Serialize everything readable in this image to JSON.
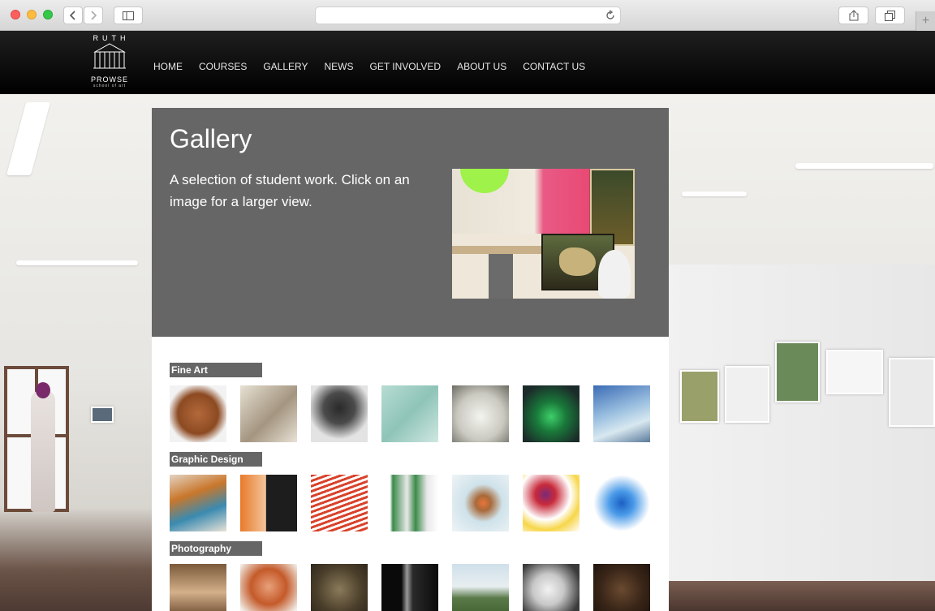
{
  "browser": {
    "url": "",
    "icons": [
      "back-icon",
      "forward-icon",
      "sidebar-icon",
      "reload-icon",
      "share-icon",
      "tabs-icon",
      "new-tab-icon"
    ]
  },
  "site": {
    "logo": {
      "line1": "RUTH",
      "line2": "PROWSE",
      "line3": "school of art"
    },
    "nav": [
      "HOME",
      "COURSES",
      "GALLERY",
      "NEWS",
      "GET INVOLVED",
      "ABOUT US",
      "CONTACT US"
    ]
  },
  "page": {
    "title": "Gallery",
    "intro": "A selection of student work. Click on an image for a larger view."
  },
  "gallery": {
    "categories": [
      {
        "name": "Fine Art",
        "thumbs": [
          {
            "bg": "radial-gradient(circle at 50% 50%, #b3693a 0%, #8c4a22 50%, #f2f2f2 75%)"
          },
          {
            "bg": "linear-gradient(135deg,#e6e0d3 0%,#a49580 55%,#e8e2d6 100%)"
          },
          {
            "bg": "radial-gradient(circle at 50% 40%, #2a2a2a 0%, #4b4b4b 35%, #e3e3e3 70%)"
          },
          {
            "bg": "linear-gradient(135deg,#b7dcd3 0%,#8fc4b8 50%,#cfe7e1 100%)"
          },
          {
            "bg": "radial-gradient(circle at 50% 55%, #f4f4ef 0%, #c9c9c0 55%, #6b6b62 100%)"
          },
          {
            "bg": "radial-gradient(circle at 50% 55%, #3dcf6a 0%, #1a7a3a 35%, #1b2b2a 80%)"
          },
          {
            "bg": "linear-gradient(160deg,#3b6bb5 0%,#9bc0e0 45%,#d8e8f0 70%,#5a7a9a 100%)"
          }
        ]
      },
      {
        "name": "Graphic Design",
        "thumbs": [
          {
            "bg": "linear-gradient(160deg,#e3d3c2 0%,#c9772b 35%,#3a8ab0 65%,#e9e2d6 100%)"
          },
          {
            "bg": "linear-gradient(90deg,#e87a2a 0%,#f4c49a 45%,#1d1d1d 46%,#1d1d1d 100%)"
          },
          {
            "bg": "repeating-linear-gradient(160deg,#d9422b 0px,#d9422b 3px,#fff 3px,#fff 6px)"
          },
          {
            "bg": "linear-gradient(90deg,#fff 0%,#fff 15%,#3b8a4a 20%,#e8e8e8 45%,#3b8a4a 60%,#e8e8e8 80%,#fff 100%)"
          },
          {
            "bg": "radial-gradient(circle at 55% 50%, #e8743a 0%, #a86a3a 18%, #cfe2ea 45%, #eef4f6 100%)"
          },
          {
            "bg": "radial-gradient(circle at 40% 35%, #7a2a7a 0%, #c82a3a 20%, #ffffff 50%, #f7d64a 70%, #ffffff 100%)"
          },
          {
            "bg": "radial-gradient(circle at 50% 50%, #1b5fc4 0%, #4a9ae8 30%, #ffffff 70%)"
          }
        ]
      },
      {
        "name": "Photography",
        "thumbs": [
          {
            "bg": "linear-gradient(#7a5a3a 0%,#d4b08a 50%,#5a3a22 100%)"
          },
          {
            "bg": "radial-gradient(circle at 50% 40%, #e8a07a 0%, #c45a2a 40%, #f2f0ea 80%)"
          },
          {
            "bg": "radial-gradient(circle at 50% 45%, #8a7a5a 0%, #4a3e2a 55%, #2a2218 100%)"
          },
          {
            "bg": "linear-gradient(90deg,#0a0a0a 0%,#0a0a0a 35%,#9a9a9a 45%,#2a2a2a 55%,#0a0a0a 100%)"
          },
          {
            "bg": "linear-gradient(#cfe0ea 0%,#e8eef0 40%,#5a7a4a 60%,#3a5a2a 100%)"
          },
          {
            "bg": "radial-gradient(circle at 45% 45%, #f2f2f2 0%, #c8c8c8 35%, #3a3a3a 75%)"
          },
          {
            "bg": "radial-gradient(circle at 50% 45%, #6a4a30 0%, #3a2618 50%, #1a100a 100%)"
          }
        ]
      }
    ]
  }
}
